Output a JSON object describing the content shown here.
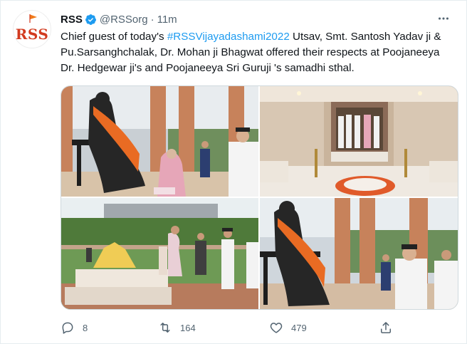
{
  "author": {
    "name": "RSS",
    "handle": "@RSSorg",
    "separator": "·",
    "time": "11m",
    "avatar_text": "RSS",
    "verified": true
  },
  "tweet": {
    "text_part1": "Chief guest of today's ",
    "hashtag": "#RSSVijayadashami2022",
    "text_part2": " Utsav, Smt. Santosh Yadav ji & Pu.Sarsanghchalak, Dr. Mohan ji Bhagwat offered their respects at Poojaneeya Dr. Hedgewar ji's and Poojaneeya Sri Guruji 's samadhi sthal."
  },
  "photos": [
    {
      "alt": "photo-1"
    },
    {
      "alt": "photo-2"
    },
    {
      "alt": "photo-3"
    },
    {
      "alt": "photo-4"
    }
  ],
  "stats": {
    "replies": "8",
    "retweets": "164",
    "likes": "479"
  },
  "icons": {
    "more": "more-horizontal-icon",
    "reply": "reply-icon",
    "retweet": "retweet-icon",
    "like": "heart-icon",
    "share": "share-icon",
    "verified": "verified-badge-icon"
  },
  "colors": {
    "accent": "#1d9bf0",
    "secondary_text": "#536471",
    "text": "#0f1419"
  }
}
